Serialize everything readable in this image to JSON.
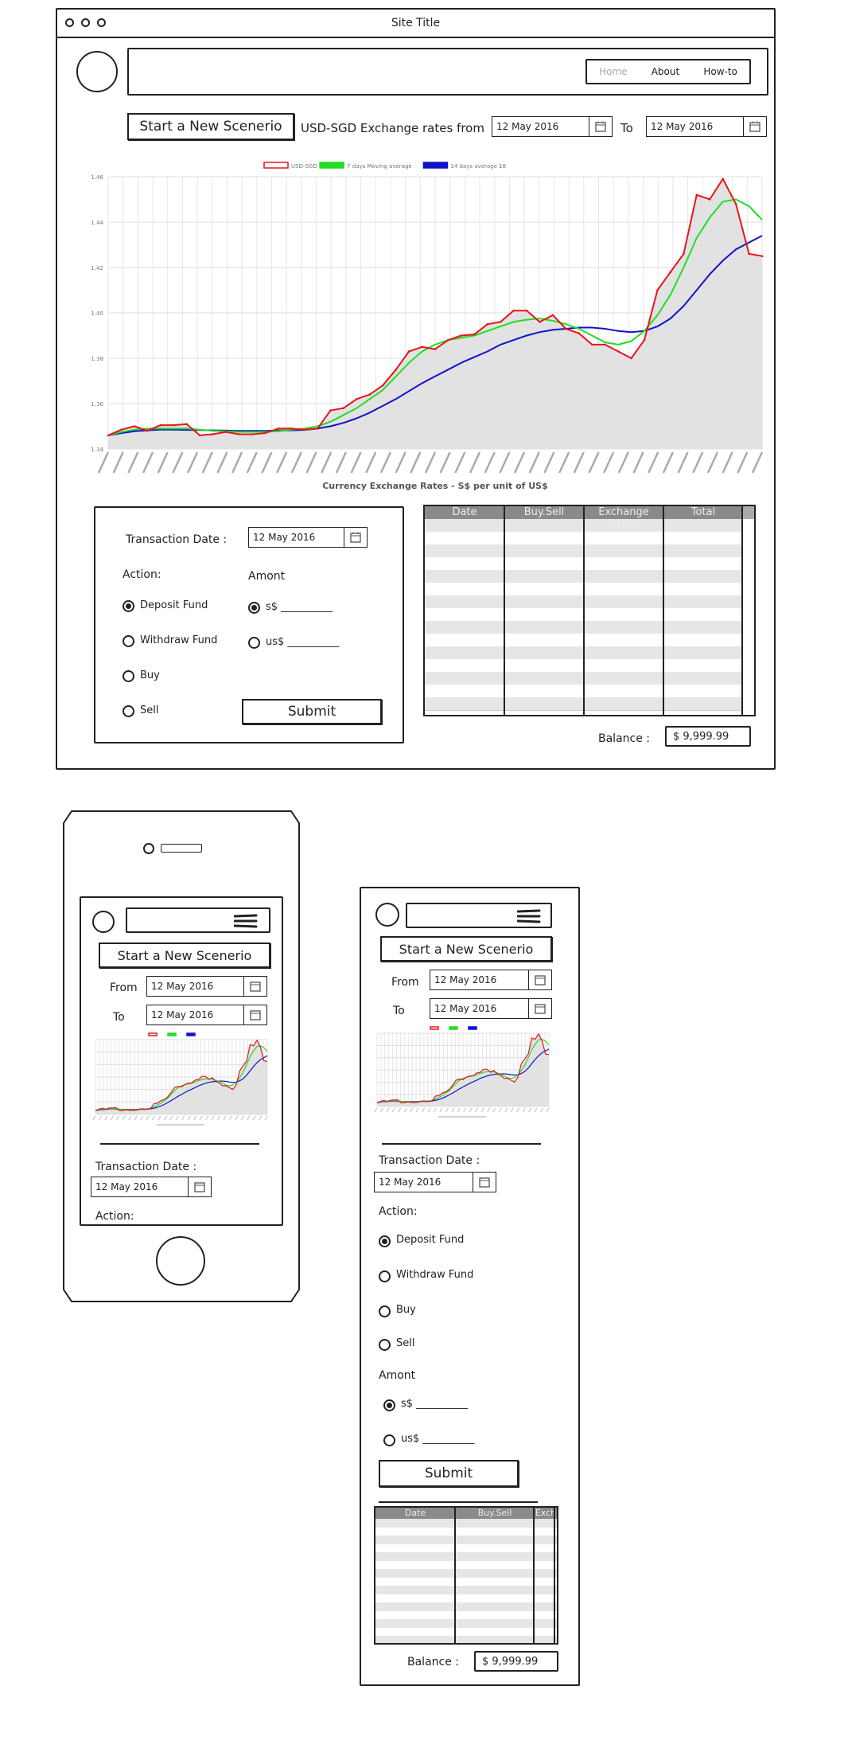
{
  "desktop": {
    "window_title": "Site Title",
    "nav": {
      "home": "Home",
      "about": "About",
      "howto": "How-to"
    },
    "new_scenario": "Start a New Scenerio",
    "rates_label": "USD-SGD Exchange rates from",
    "from_date": "12 May 2016",
    "to_label": "To",
    "to_date": "12 May 2016",
    "transaction_date_label": "Transaction Date :",
    "transaction_date": "12 May 2016",
    "action_label": "Action:",
    "actions": [
      "Deposit Fund",
      "Withdraw Fund",
      "Buy",
      "Sell"
    ],
    "amount_label": "Amont",
    "amounts": [
      "s$ __________",
      "us$ __________"
    ],
    "submit": "Submit",
    "table_headers": [
      "Date",
      "Buy.Sell",
      "Exchange Rates",
      "Total"
    ],
    "balance_label": "Balance :",
    "balance_value": "$ 9,999.99"
  },
  "phone": {
    "new_scenario": "Start a New Scenerio",
    "from_label": "From",
    "from_date": "12 May 2016",
    "to_label": "To",
    "to_date": "12 May 2016",
    "transaction_date_label": "Transaction Date :",
    "transaction_date": "12 May 2016",
    "action_label": "Action:"
  },
  "tablet": {
    "new_scenario": "Start a New Scenerio",
    "from_label": "From",
    "from_date": "12 May 2016",
    "to_label": "To",
    "to_date": "12 May 2016",
    "transaction_date_label": "Transaction Date :",
    "transaction_date": "12 May 2016",
    "action_label": "Action:",
    "actions": [
      "Deposit Fund",
      "Withdraw Fund",
      "Buy",
      "Sell"
    ],
    "amount_label": "Amont",
    "amounts": [
      "s$ __________",
      "us$ __________"
    ],
    "submit": "Submit",
    "table_headers": [
      "Date",
      "Buy.Sell",
      "Exch"
    ],
    "balance_label": "Balance :",
    "balance_value": "$ 9,999.99"
  },
  "colors": {
    "red": "#e8141a",
    "green": "#22dd22",
    "blue": "#1111cc",
    "fill": "#e2e2e2",
    "header": "#888888"
  },
  "chart_data": {
    "type": "line",
    "title": "Currency Exchange Rates - S$ per unit of US$",
    "legend_position": "top-center",
    "grid": true,
    "ylim": [
      1.34,
      1.46
    ],
    "yticks": [
      "1.34",
      "1.36",
      "1.38",
      "1.40",
      "1.42",
      "1.44",
      "1.46"
    ],
    "x_tick_count": 45,
    "series": [
      {
        "name": "USD-SGD",
        "color": "#e8141a",
        "values": [
          1.346,
          1.3485,
          1.35,
          1.348,
          1.3505,
          1.3505,
          1.351,
          1.346,
          1.3465,
          1.3475,
          1.3465,
          1.3465,
          1.347,
          1.349,
          1.349,
          1.3485,
          1.349,
          1.357,
          1.358,
          1.362,
          1.364,
          1.368,
          1.375,
          1.383,
          1.385,
          1.384,
          1.388,
          1.39,
          1.3905,
          1.395,
          1.396,
          1.401,
          1.401,
          1.396,
          1.399,
          1.393,
          1.391,
          1.386,
          1.386,
          1.383,
          1.38,
          1.388,
          1.41,
          1.418,
          1.426,
          1.452,
          1.45,
          1.459,
          1.448,
          1.426,
          1.425
        ]
      },
      {
        "name": "7 days Moving average",
        "color": "#22dd22",
        "values": [
          1.346,
          1.3475,
          1.3485,
          1.349,
          1.349,
          1.349,
          1.349,
          1.3485,
          1.348,
          1.3478,
          1.3475,
          1.3475,
          1.3475,
          1.3478,
          1.3485,
          1.349,
          1.35,
          1.352,
          1.355,
          1.358,
          1.362,
          1.366,
          1.372,
          1.378,
          1.383,
          1.386,
          1.388,
          1.389,
          1.39,
          1.392,
          1.394,
          1.396,
          1.397,
          1.3975,
          1.3965,
          1.395,
          1.393,
          1.39,
          1.387,
          1.386,
          1.3875,
          1.392,
          1.399,
          1.408,
          1.42,
          1.433,
          1.442,
          1.449,
          1.45,
          1.447,
          1.441
        ]
      },
      {
        "name": "14 days average 18",
        "color": "#1111cc",
        "values": [
          1.346,
          1.347,
          1.3478,
          1.3482,
          1.3485,
          1.3485,
          1.3484,
          1.3483,
          1.3482,
          1.3481,
          1.348,
          1.348,
          1.348,
          1.3481,
          1.3482,
          1.3484,
          1.349,
          1.35,
          1.3515,
          1.3535,
          1.356,
          1.359,
          1.362,
          1.3655,
          1.369,
          1.372,
          1.375,
          1.378,
          1.3805,
          1.383,
          1.386,
          1.388,
          1.39,
          1.3915,
          1.3925,
          1.393,
          1.3935,
          1.3935,
          1.393,
          1.392,
          1.3915,
          1.392,
          1.394,
          1.3975,
          1.403,
          1.41,
          1.417,
          1.423,
          1.428,
          1.431,
          1.434
        ]
      }
    ]
  }
}
